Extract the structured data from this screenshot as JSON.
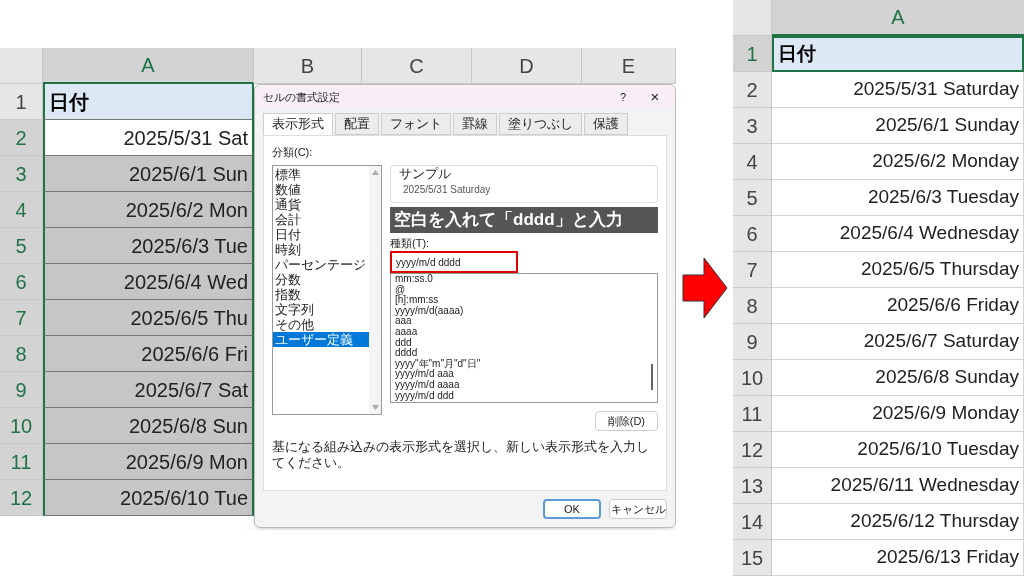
{
  "before_sheet": {
    "columns": [
      {
        "label": "A",
        "selected": true
      },
      {
        "label": "B",
        "selected": false
      },
      {
        "label": "C",
        "selected": false
      },
      {
        "label": "D",
        "selected": false
      },
      {
        "label": "E",
        "selected": false
      }
    ],
    "rows": [
      {
        "number": "1",
        "kind": "header",
        "text": "日付"
      },
      {
        "number": "2",
        "kind": "active",
        "text": "2025/5/31 Sat"
      },
      {
        "number": "3",
        "kind": "selected",
        "text": "2025/6/1 Sun"
      },
      {
        "number": "4",
        "kind": "selected",
        "text": "2025/6/2 Mon"
      },
      {
        "number": "5",
        "kind": "selected",
        "text": "2025/6/3 Tue"
      },
      {
        "number": "6",
        "kind": "selected",
        "text": "2025/6/4 Wed"
      },
      {
        "number": "7",
        "kind": "selected",
        "text": "2025/6/5 Thu"
      },
      {
        "number": "8",
        "kind": "selected",
        "text": "2025/6/6 Fri"
      },
      {
        "number": "9",
        "kind": "selected",
        "text": "2025/6/7 Sat"
      },
      {
        "number": "10",
        "kind": "selected",
        "text": "2025/6/8 Sun"
      },
      {
        "number": "11",
        "kind": "selected",
        "text": "2025/6/9 Mon"
      },
      {
        "number": "12",
        "kind": "selected",
        "text": "2025/6/10 Tue"
      }
    ]
  },
  "dialog": {
    "title": "セルの書式設定",
    "help": "?",
    "close": "×",
    "tabs": [
      {
        "label": "表示形式",
        "selected": true
      },
      {
        "label": "配置",
        "selected": false
      },
      {
        "label": "フォント",
        "selected": false
      },
      {
        "label": "罫線",
        "selected": false
      },
      {
        "label": "塗りつぶし",
        "selected": false
      },
      {
        "label": "保護",
        "selected": false
      }
    ],
    "category_label": "分類(C):",
    "categories": [
      {
        "label": "標準",
        "selected": false
      },
      {
        "label": "数値",
        "selected": false
      },
      {
        "label": "通貨",
        "selected": false
      },
      {
        "label": "会計",
        "selected": false
      },
      {
        "label": "日付",
        "selected": false
      },
      {
        "label": "時刻",
        "selected": false
      },
      {
        "label": "パーセンテージ",
        "selected": false
      },
      {
        "label": "分数",
        "selected": false
      },
      {
        "label": "指数",
        "selected": false
      },
      {
        "label": "文字列",
        "selected": false
      },
      {
        "label": "その他",
        "selected": false
      },
      {
        "label": "ユーザー定義",
        "selected": true
      }
    ],
    "sample_label": "サンプル",
    "sample_value": "2025/5/31 Saturday",
    "annotation": "空白を入れて「dddd」と入力",
    "type_label": "種類(T):",
    "type_value": "yyyy/m/d dddd",
    "type_highlighted": true,
    "formats": [
      "mm:ss.0",
      "@",
      "[h]:mm:ss",
      "yyyy/m/d(aaaa)",
      "aaa",
      "aaaa",
      "ddd",
      "dddd",
      "yyyy\"年\"m\"月\"d\"日\"",
      "yyyy/m/d aaa",
      "yyyy/m/d aaaa",
      "yyyy/m/d ddd"
    ],
    "delete_button": "削除(D)",
    "description": "基になる組み込みの表示形式を選択し、新しい表示形式を入力してください。",
    "buttons": [
      {
        "label": "OK",
        "kind": "primary"
      },
      {
        "label": "キャンセル",
        "kind": "secondary"
      }
    ]
  },
  "after_sheet": {
    "column": {
      "label": "A",
      "selected": true
    },
    "rows": [
      {
        "number": "1",
        "kind": "header",
        "text": "日付"
      },
      {
        "number": "2",
        "kind": "date",
        "text": "2025/5/31 Saturday"
      },
      {
        "number": "3",
        "kind": "date",
        "text": "2025/6/1 Sunday"
      },
      {
        "number": "4",
        "kind": "date",
        "text": "2025/6/2 Monday"
      },
      {
        "number": "5",
        "kind": "date",
        "text": "2025/6/3 Tuesday"
      },
      {
        "number": "6",
        "kind": "date",
        "text": "2025/6/4 Wednesday"
      },
      {
        "number": "7",
        "kind": "date",
        "text": "2025/6/5 Thursday"
      },
      {
        "number": "8",
        "kind": "date",
        "text": "2025/6/6 Friday"
      },
      {
        "number": "9",
        "kind": "date",
        "text": "2025/6/7 Saturday"
      },
      {
        "number": "10",
        "kind": "date",
        "text": "2025/6/8 Sunday"
      },
      {
        "number": "11",
        "kind": "date",
        "text": "2025/6/9 Monday"
      },
      {
        "number": "12",
        "kind": "date",
        "text": "2025/6/10 Tuesday"
      },
      {
        "number": "13",
        "kind": "date",
        "text": "2025/6/11 Wednesday"
      },
      {
        "number": "14",
        "kind": "date",
        "text": "2025/6/12 Thursday"
      },
      {
        "number": "15",
        "kind": "date",
        "text": "2025/6/13 Friday"
      }
    ]
  }
}
